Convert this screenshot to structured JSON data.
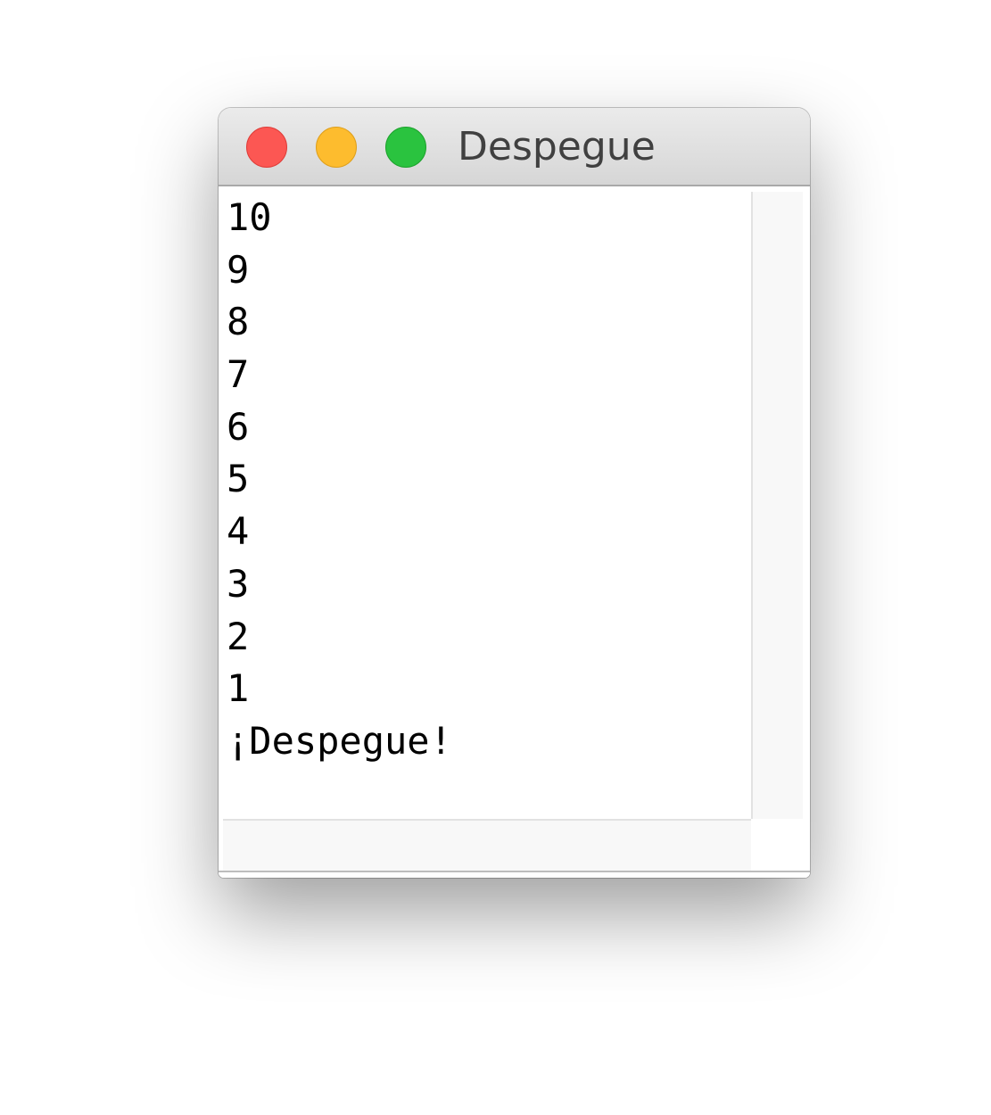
{
  "window": {
    "title": "Despegue",
    "controls": {
      "close_color": "#fc5753",
      "minimize_color": "#fdbc2e",
      "zoom_color": "#2ac33f"
    }
  },
  "output": {
    "lines": [
      "10",
      "9",
      "8",
      "7",
      "6",
      "5",
      "4",
      "3",
      "2",
      "1",
      "¡Despegue!"
    ]
  }
}
